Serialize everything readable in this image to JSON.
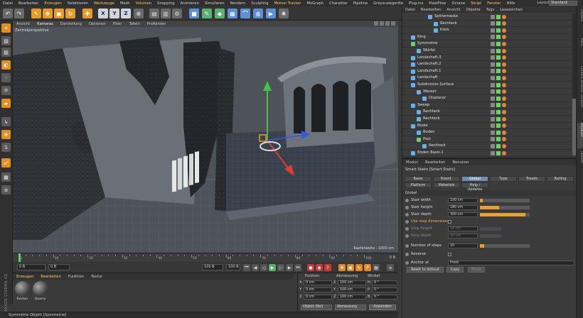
{
  "menubar": {
    "items": [
      "Datei",
      "Bearbeiten",
      "Erzeugen",
      "Selektieren",
      "Werkzeuge",
      "Mesh",
      "Volumen",
      "Snapping",
      "Animieren",
      "Simulieren",
      "Rendern",
      "Sculpting",
      "Motion Tracker",
      "MoGraph",
      "Charakter",
      "Pipeline",
      "Greyscalegorilla",
      "Plug-ins",
      "PixelPlow",
      "Octane",
      "Skript",
      "Fenster",
      "Hilfe"
    ],
    "highlighted": [
      "Erzeugen",
      "Werkzeuge",
      "Volumen",
      "Motion Tracker",
      "Skript",
      "Fenster"
    ],
    "layout_label": "Layout:",
    "layout_value": "Standard"
  },
  "toolbar": {
    "axis_x": "X",
    "axis_y": "Y",
    "axis_z": "Z"
  },
  "viewport": {
    "menu": [
      "Ansicht",
      "Kameras",
      "Darstellung",
      "Optionen",
      "Filter",
      "Tafeln",
      "ProRender"
    ],
    "active_menu": "Kameras",
    "camera_name": "Zentralperspektive",
    "raster_label": "Rasterweite : 1000 cm"
  },
  "timeline": {
    "ticks": [
      "0",
      "10",
      "20",
      "30",
      "40",
      "50",
      "60",
      "70",
      "80",
      "90",
      "100"
    ],
    "end_label": "0 B"
  },
  "transport": {
    "start_frame": "0 B",
    "current_frame": "0 B",
    "end_frame": "100 B",
    "end_frame2": "100 B"
  },
  "material_manager": {
    "menu": [
      "Erzeugen",
      "Bearbeiten",
      "Funktion",
      "Textur"
    ],
    "highlighted": [
      "Erzeugen",
      "Bearbeiten"
    ],
    "materials": [
      {
        "name": "Rostan"
      },
      {
        "name": "Quarry"
      }
    ]
  },
  "coordinates": {
    "headers": {
      "position": "Position",
      "size": "Abmessung",
      "rotation": "Winkel"
    },
    "rows": [
      {
        "axis": "X",
        "pos": "0 cm",
        "size": "100 cm",
        "rot_axis": "H",
        "rot": "0 °"
      },
      {
        "axis": "Y",
        "pos": "0 cm",
        "size": "100 cm",
        "rot_axis": "P",
        "rot": "0 °"
      },
      {
        "axis": "Z",
        "pos": "0 cm",
        "size": "100 cm",
        "rot_axis": "B",
        "rot": "0 °"
      }
    ],
    "mode_select": "Objekt (Rel)",
    "size_select": "Abmessung",
    "apply_label": "Anwenden"
  },
  "statusbar": {
    "text": "Symmetrie Objekt [Symmetrie]"
  },
  "brand": "MAXON CINEMA 4D",
  "object_manager": {
    "menu": [
      "Datei",
      "Bearbeiten",
      "Ansicht",
      "Objekte",
      "Tags",
      "Lesezeichen"
    ],
    "rows": [
      {
        "name": "Splinemaske",
        "indent": 4,
        "color": "#6ab0e6"
      },
      {
        "name": "Rechteck",
        "indent": 5,
        "color": "#6ab0e6"
      },
      {
        "name": "Kreis",
        "indent": 5,
        "color": "#6ab0e6"
      },
      {
        "name": "Ring",
        "indent": 1,
        "color": "#6ab0e6"
      },
      {
        "name": "Symmetrie",
        "indent": 1,
        "color": "#6fd06f"
      },
      {
        "name": "Würfel",
        "indent": 2,
        "color": "#6ab0e6"
      },
      {
        "name": "Landschaft.3",
        "indent": 1,
        "color": "#6ab0e6"
      },
      {
        "name": "Landschaft.2",
        "indent": 1,
        "color": "#6ab0e6"
      },
      {
        "name": "Landschaft.1",
        "indent": 1,
        "color": "#6ab0e6"
      },
      {
        "name": "Landschaft",
        "indent": 1,
        "color": "#6ab0e6"
      },
      {
        "name": "Subdivision Surface",
        "indent": 1,
        "color": "#6ab0e6"
      },
      {
        "name": "Wasser",
        "indent": 2,
        "color": "#6ab0e6"
      },
      {
        "name": "Displacer",
        "indent": 3,
        "color": "#6ab0e6"
      },
      {
        "name": "Sweep",
        "indent": 1,
        "color": "#6ab0e6"
      },
      {
        "name": "Rechteck",
        "indent": 2,
        "color": "#6ab0e6"
      },
      {
        "name": "Rechteck",
        "indent": 2,
        "color": "#6ab0e6"
      },
      {
        "name": "Boole",
        "indent": 1,
        "color": "#6ab0e6"
      },
      {
        "name": "Boden",
        "indent": 2,
        "color": "#6ab0e6"
      },
      {
        "name": "Pool",
        "indent": 2,
        "color": "#6fd06f"
      },
      {
        "name": "Rechteck",
        "indent": 3,
        "color": "#6ab0e6"
      },
      {
        "name": "Boden Basis.1",
        "indent": 1,
        "color": "#6ab0e6"
      }
    ]
  },
  "attribute_manager": {
    "menu": [
      "Modus",
      "Bearbeiten",
      "Benutzer"
    ],
    "title": "Smart Stairs [Smart Stairs]",
    "tabs_row1": [
      "Basis",
      "Koord.",
      "Global",
      "Type",
      "Treads",
      "Railing"
    ],
    "active_tab": "Global",
    "tabs_row2": [
      "Platform",
      "Materials",
      "Help / Updates"
    ],
    "section": "Global",
    "params": [
      {
        "label": "Stair width",
        "value": "100 cm",
        "fill": 0.05,
        "dim": false,
        "hl": false
      },
      {
        "label": "Stair height",
        "value": "180 cm",
        "fill": 0.38,
        "dim": false,
        "hl": false
      },
      {
        "label": "Stair depth",
        "value": "300 cm",
        "fill": 0.92,
        "dim": false,
        "hl": false
      }
    ],
    "use_step_label": "Use step dimensions",
    "step_params": [
      {
        "label": "Step height",
        "value": "18 cm"
      },
      {
        "label": "Step depth",
        "value": "30 cm"
      }
    ],
    "num_steps_label": "Number of steps",
    "num_steps_value": "10",
    "num_steps_fill": 0.08,
    "reverse_label": "Reverse",
    "anchor_label": "Anchor at",
    "anchor_value": "Front",
    "buttons": {
      "reset": "Reset to default",
      "copy": "Copy",
      "paste": "Paste"
    }
  },
  "right_strip": [
    "Objekte",
    "Takes",
    "Content Browser",
    "Struktur",
    "Attribute",
    "Ebenen"
  ]
}
